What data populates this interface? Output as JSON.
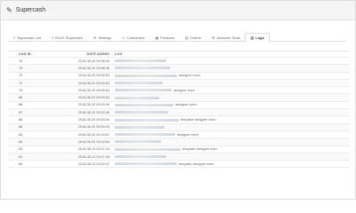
{
  "header": {
    "title": "Supercash",
    "icon": "pencil-icon"
  },
  "tabs": [
    {
      "label": "Supercash List",
      "icon": "list-icon",
      "active": false
    },
    {
      "label": "BULK Supercash",
      "icon": "list-icon",
      "active": false
    },
    {
      "label": "Settings",
      "icon": "gear-icon",
      "active": false
    },
    {
      "label": "Customers",
      "icon": "user-icon",
      "active": false
    },
    {
      "label": "Products",
      "icon": "box-icon",
      "active": false
    },
    {
      "label": "Orders",
      "icon": "cart-icon",
      "active": false
    },
    {
      "label": "Advance Tools",
      "icon": "wrench-icon",
      "active": false
    },
    {
      "label": "Logs",
      "icon": "book-icon",
      "active": true
    }
  ],
  "table": {
    "columns": {
      "id": "LOG ID",
      "date": "DATE ADDED",
      "log": "LOG"
    },
    "rows": [
      {
        "id": "74",
        "date": "2018-08-20 09:56:46",
        "suffix": ""
      },
      {
        "id": "73",
        "date": "2018-08-20 09:56:46",
        "suffix": ""
      },
      {
        "id": "72",
        "date": "2018-08-20 09:55:53",
        "suffix": "designer even"
      },
      {
        "id": "71",
        "date": "2018-08-20 09:55:53",
        "suffix": ""
      },
      {
        "id": "70",
        "date": "2018-08-20 09:55:53",
        "suffix": "designer even"
      },
      {
        "id": "69",
        "date": "2018-08-20 09:55:53",
        "suffix": ""
      },
      {
        "id": "68",
        "date": "2018-08-20 09:52:49",
        "suffix": "designer even"
      },
      {
        "id": "67",
        "date": "2018-08-20 09:52:49",
        "suffix": ""
      },
      {
        "id": "66",
        "date": "2018-08-20 09:50:04",
        "suffix": "template designer even"
      },
      {
        "id": "65",
        "date": "2018-08-20 09:50:04",
        "suffix": ""
      },
      {
        "id": "64",
        "date": "2018-08-20 09:49:57",
        "suffix": "designer even"
      },
      {
        "id": "63",
        "date": "2018-08-20 09:49:54",
        "suffix": ""
      },
      {
        "id": "62",
        "date": "2018-08-13 03:47:43",
        "suffix": "template designer even"
      },
      {
        "id": "61",
        "date": "2018-08-13 03:47:43",
        "suffix": ""
      },
      {
        "id": "60",
        "date": "2018-08-13 03:30:47",
        "suffix": "template designer even"
      }
    ]
  }
}
